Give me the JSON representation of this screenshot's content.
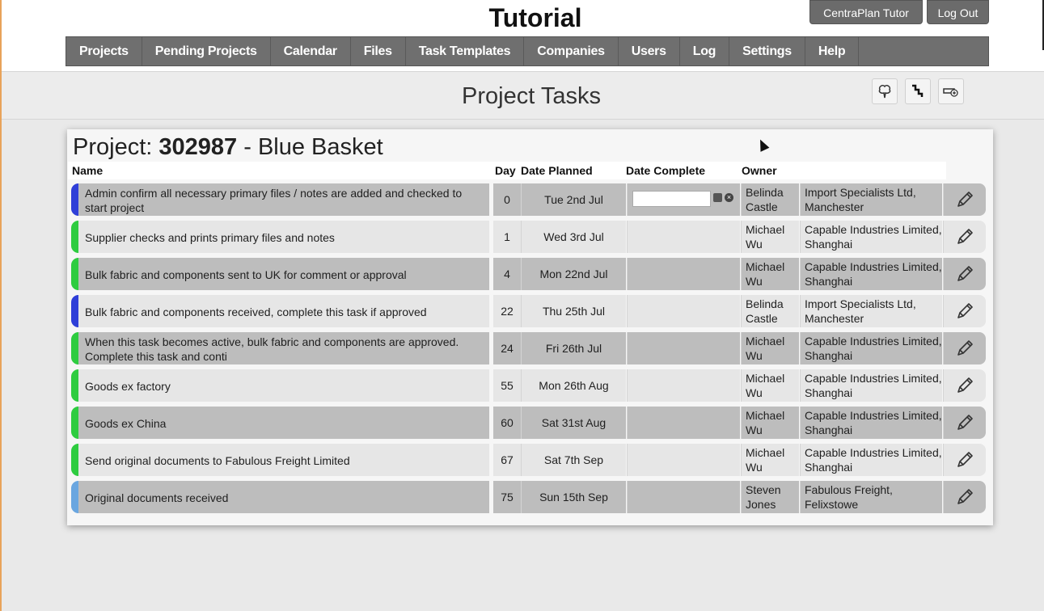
{
  "app": {
    "title": "Tutorial"
  },
  "top_buttons": {
    "tutor": "CentraPlan Tutor",
    "logout": "Log Out"
  },
  "nav": [
    "Projects",
    "Pending Projects",
    "Calendar",
    "Files",
    "Task Templates",
    "Companies",
    "Users",
    "Log",
    "Settings",
    "Help"
  ],
  "page": {
    "title": "Project Tasks"
  },
  "toolbar_icons": [
    "brain-icon",
    "stairs-icon",
    "add-tag-icon"
  ],
  "project": {
    "prefix": "Project: ",
    "number": "302987",
    "separator": " - ",
    "name": "Blue Basket"
  },
  "columns": {
    "name": "Name",
    "day": "Day",
    "date_planned": "Date Planned",
    "date_complete": "Date Complete",
    "owner": "Owner"
  },
  "colors": {
    "stripe_blue": "#2f3fd8",
    "stripe_green": "#2ecc40",
    "stripe_light_blue": "#6aa6e0"
  },
  "tasks": [
    {
      "name": "Admin confirm all necessary primary files / notes are added and checked to start project",
      "day": "0",
      "date_planned": "Tue 2nd Jul",
      "date_complete": "",
      "person": "Belinda Castle",
      "company": "Import Specialists Ltd, Manchester",
      "stripe": "blue"
    },
    {
      "name": "Supplier checks and prints primary files and notes",
      "day": "1",
      "date_planned": "Wed 3rd Jul",
      "date_complete": "",
      "person": "Michael Wu",
      "company": "Capable Industries Limited, Shanghai",
      "stripe": "green"
    },
    {
      "name": "Bulk fabric and components sent to UK for comment or approval",
      "day": "4",
      "date_planned": "Mon 22nd Jul",
      "date_complete": "",
      "person": "Michael Wu",
      "company": "Capable Industries Limited, Shanghai",
      "stripe": "green"
    },
    {
      "name": "Bulk fabric and components received, complete this task if approved",
      "day": "22",
      "date_planned": "Thu 25th Jul",
      "date_complete": "",
      "person": "Belinda Castle",
      "company": "Import Specialists Ltd, Manchester",
      "stripe": "blue"
    },
    {
      "name": "When this task becomes active, bulk fabric and components are approved. Complete this task and conti",
      "day": "24",
      "date_planned": "Fri 26th Jul",
      "date_complete": "",
      "person": "Michael Wu",
      "company": "Capable Industries Limited, Shanghai",
      "stripe": "green"
    },
    {
      "name": "Goods ex factory",
      "day": "55",
      "date_planned": "Mon 26th Aug",
      "date_complete": "",
      "person": "Michael Wu",
      "company": "Capable Industries Limited, Shanghai",
      "stripe": "green"
    },
    {
      "name": "Goods ex China",
      "day": "60",
      "date_planned": "Sat 31st Aug",
      "date_complete": "",
      "person": "Michael Wu",
      "company": "Capable Industries Limited, Shanghai",
      "stripe": "green"
    },
    {
      "name": "Send original documents to Fabulous Freight Limited",
      "day": "67",
      "date_planned": "Sat 7th Sep",
      "date_complete": "",
      "person": "Michael Wu",
      "company": "Capable Industries Limited, Shanghai",
      "stripe": "green"
    },
    {
      "name": "Original documents received",
      "day": "75",
      "date_planned": "Sun 15th Sep",
      "date_complete": "",
      "person": "Steven Jones",
      "company": "Fabulous Freight, Felixstowe",
      "stripe": "light_blue"
    }
  ]
}
